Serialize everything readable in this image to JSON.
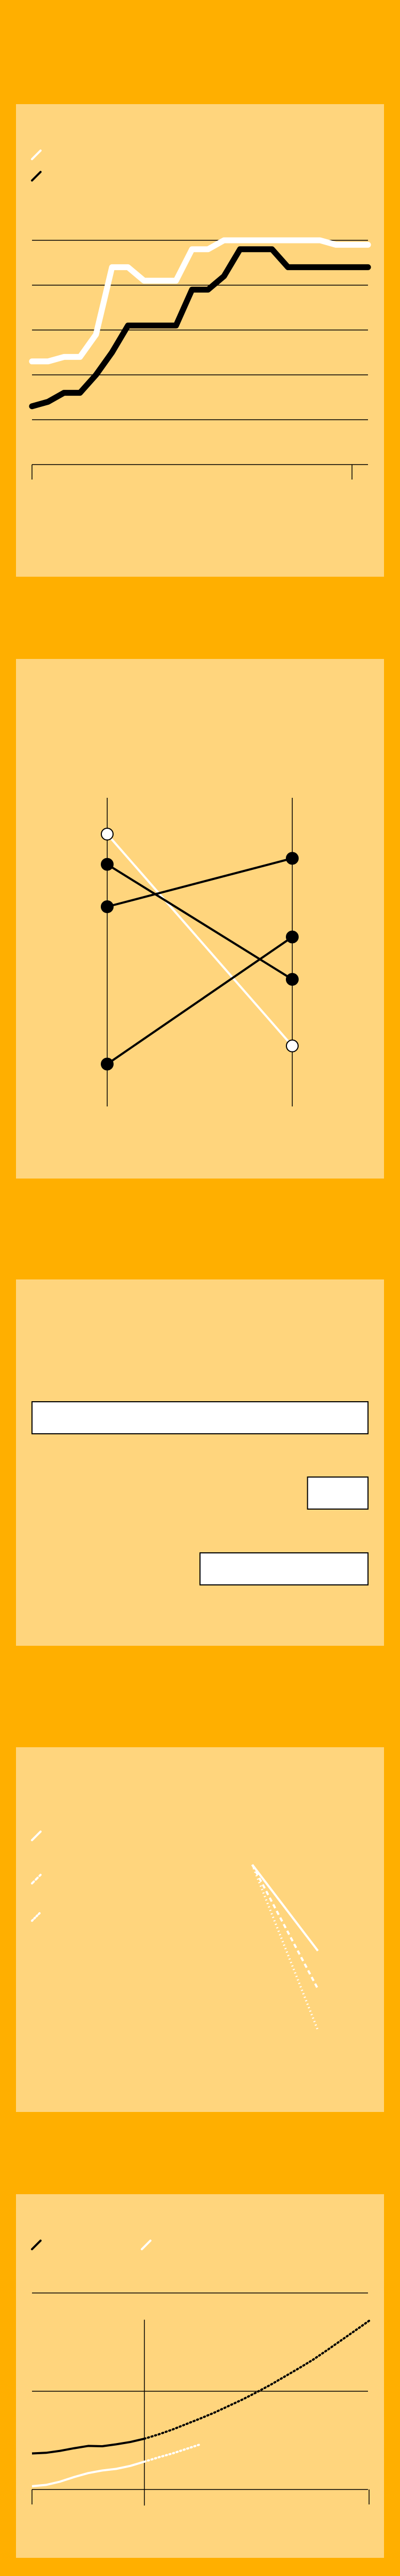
{
  "page": {
    "background": "#FFAF00",
    "panel_color": "#FFD57D"
  },
  "chart_data": [
    {
      "type": "line",
      "title": "",
      "xlabel": "",
      "ylabel": "",
      "x": [
        0,
        1,
        2,
        3,
        4,
        5,
        6,
        7,
        8,
        9,
        10,
        11,
        12,
        13,
        14,
        15,
        16,
        17,
        18,
        19,
        20,
        21
      ],
      "series": [
        {
          "color": "#FFFFFF",
          "values": [
            2.3,
            2.3,
            2.4,
            2.4,
            2.9,
            4.4,
            4.4,
            4.1,
            4.1,
            4.1,
            4.8,
            4.8,
            5.0,
            5.0,
            5.0,
            5.0,
            5.0,
            5.0,
            5.0,
            4.9,
            4.9,
            4.9
          ]
        },
        {
          "color": "#000000",
          "values": [
            1.3,
            1.4,
            1.6,
            1.6,
            2.0,
            2.5,
            3.1,
            3.1,
            3.1,
            3.1,
            3.9,
            3.9,
            4.2,
            4.8,
            4.8,
            4.8,
            4.4,
            4.4,
            4.4,
            4.4,
            4.4,
            4.4
          ]
        }
      ],
      "xlim": [
        0,
        21
      ],
      "ylim": [
        0,
        5
      ],
      "grid": true,
      "legend": "top-left"
    },
    {
      "type": "line",
      "subtype": "slope",
      "title": "",
      "categories": [
        "",
        ""
      ],
      "series": [
        {
          "color": "#FFFFFF",
          "values": [
            4.8,
            1.3
          ]
        },
        {
          "color": "#000000",
          "values": [
            4.3,
            2.4
          ]
        },
        {
          "color": "#000000",
          "values": [
            3.6,
            4.4
          ]
        },
        {
          "color": "#000000",
          "values": [
            1.0,
            3.1
          ]
        }
      ],
      "ylim": [
        0.3,
        5.4
      ],
      "grid": false
    },
    {
      "type": "bar",
      "orientation": "horizontal",
      "title": "",
      "categories": [
        "",
        "",
        ""
      ],
      "values": [
        100,
        18,
        50
      ],
      "xlim": [
        0,
        100
      ],
      "grid": false
    },
    {
      "type": "line",
      "title": "",
      "x": [
        0,
        1
      ],
      "series": [
        {
          "color": "#FFFFFF",
          "style": "solid",
          "values": [
            100,
            48
          ]
        },
        {
          "color": "#FFFFFF",
          "style": "dashed",
          "values": [
            100,
            25
          ]
        },
        {
          "color": "#FFFFFF",
          "style": "dotted",
          "values": [
            100,
            0
          ]
        }
      ],
      "xlim": [
        0,
        1
      ],
      "ylim": [
        0,
        100
      ],
      "grid": false,
      "legend": "top-left"
    },
    {
      "type": "line",
      "title": "",
      "x": [
        0,
        1,
        2,
        3,
        4,
        5,
        6,
        7,
        8,
        9,
        10,
        11,
        12,
        13,
        14,
        15,
        16,
        17,
        18,
        19,
        20,
        21,
        22,
        23,
        24
      ],
      "split_index": 8,
      "series": [
        {
          "color": "#000000",
          "values": [
            1.1,
            1.12,
            1.18,
            1.26,
            1.33,
            1.32,
            1.38,
            1.45,
            1.55,
            1.68,
            1.83,
            2.0,
            2.17,
            2.35,
            2.55,
            2.75,
            2.97,
            3.2,
            3.45,
            3.7,
            3.96,
            4.25,
            4.55,
            4.85,
            5.15
          ]
        },
        {
          "color": "#FFFFFF",
          "values": [
            0.1,
            0.14,
            0.24,
            0.38,
            0.5,
            0.58,
            0.63,
            0.72,
            0.85,
            0.98,
            1.1,
            1.24,
            1.38
          ]
        }
      ],
      "xlim": [
        0,
        24
      ],
      "ylim": [
        0,
        6
      ],
      "grid": true,
      "legend": "top-left"
    }
  ]
}
